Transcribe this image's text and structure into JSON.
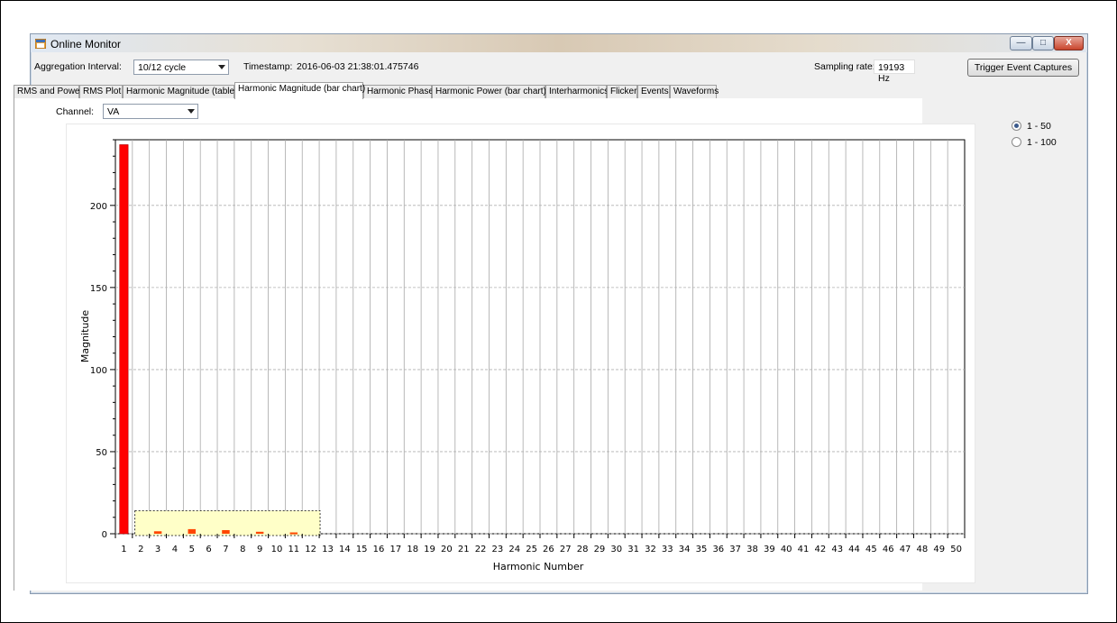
{
  "window": {
    "title": "Online Monitor",
    "controls": {
      "minimize": "—",
      "maximize": "□",
      "close": "X"
    }
  },
  "toolbar": {
    "aggregation_label": "Aggregation Interval:",
    "aggregation_value": "10/12 cycle",
    "timestamp_label": "Timestamp:",
    "timestamp_value": "2016-06-03 21:38:01.475746",
    "sampling_label": "Sampling rate:",
    "sampling_value": "19193 Hz",
    "trigger_button": "Trigger Event Captures"
  },
  "tabs": [
    "RMS and Power",
    "RMS Plot",
    "Harmonic Magnitude (table)",
    "Harmonic Magnitude (bar chart)",
    "Harmonic Phase",
    "Harmonic Power (bar chart)",
    "Interharmonics",
    "Flicker",
    "Events",
    "Waveforms"
  ],
  "active_tab": "Harmonic Magnitude (bar chart)",
  "channel": {
    "label": "Channel:",
    "value": "VA"
  },
  "range_options": [
    {
      "label": "1 - 50",
      "selected": true
    },
    {
      "label": "1 - 100",
      "selected": false
    }
  ],
  "colors": {
    "fundamental_bar": "#ff0000",
    "harmonic_bar": "#ff4500",
    "selection_fill": "#ffffc8"
  },
  "chart_data": {
    "type": "bar",
    "xlabel": "Harmonic Number",
    "ylabel": "Magnitude",
    "ylim": [
      0,
      240
    ],
    "yticks": [
      0,
      50,
      100,
      150,
      200
    ],
    "categories": [
      1,
      2,
      3,
      4,
      5,
      6,
      7,
      8,
      9,
      10,
      11,
      12,
      13,
      14,
      15,
      16,
      17,
      18,
      19,
      20,
      21,
      22,
      23,
      24,
      25,
      26,
      27,
      28,
      29,
      30,
      31,
      32,
      33,
      34,
      35,
      36,
      37,
      38,
      39,
      40,
      41,
      42,
      43,
      44,
      45,
      46,
      47,
      48,
      49,
      50
    ],
    "values": [
      237,
      0,
      1.5,
      0,
      2.8,
      0,
      2.2,
      0,
      1.2,
      0,
      0.8,
      0,
      0,
      0,
      0,
      0,
      0,
      0,
      0,
      0,
      0,
      0,
      0,
      0,
      0,
      0,
      0,
      0,
      0,
      0,
      0,
      0,
      0,
      0,
      0,
      0,
      0,
      0,
      0,
      0,
      0,
      0,
      0,
      0,
      0,
      0,
      0,
      0,
      0,
      0
    ],
    "grid": true,
    "selection_range": [
      2,
      12
    ]
  }
}
